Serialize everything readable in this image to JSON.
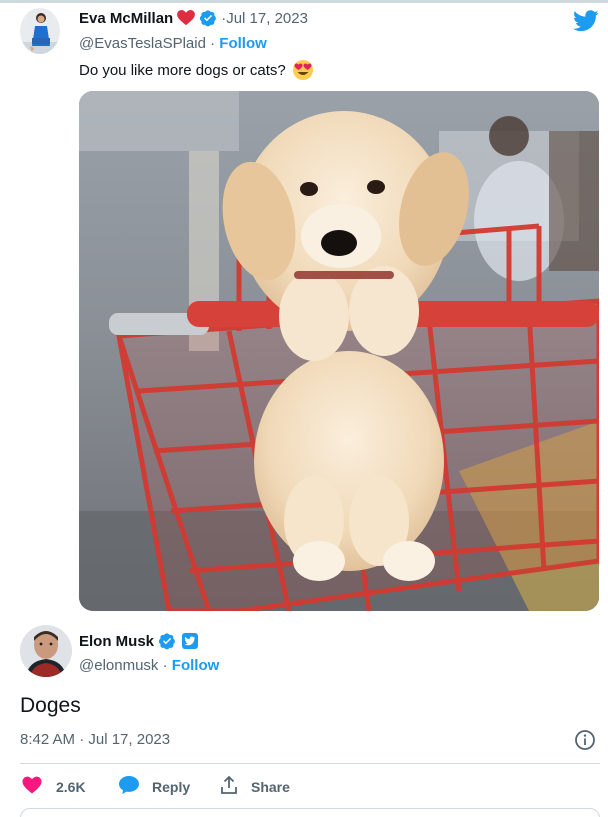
{
  "colors": {
    "accent": "#1d9bf0",
    "text": "#0f1419",
    "muted": "#536471",
    "divider": "#cfd9de",
    "like": "#f91880"
  },
  "quoted_tweet": {
    "author_name": "Eva McMillan",
    "emoji_after_name": "red-heart",
    "date": "Jul 17, 2023",
    "date_prefix": "· ",
    "handle": "@EvasTeslaSPlaid",
    "follow_separator": " · ",
    "follow_label": "Follow",
    "text": "Do you like more dogs or cats?",
    "text_emoji": "heart-eyes-emoji",
    "media": "puppy-in-shopping-cart-photo"
  },
  "main_tweet": {
    "author_name": "Elon Musk",
    "handle": "@elonmusk",
    "follow_separator": " · ",
    "follow_label": "Follow",
    "text": "Doges",
    "timestamp": "8:42 AM · Jul 17, 2023"
  },
  "actions": {
    "likes_count": "2.6K",
    "reply_label": "Reply",
    "share_label": "Share"
  },
  "icons": {
    "brand": "twitter-bird-icon",
    "verified": "verified-badge-icon",
    "info": "info-icon",
    "like": "heart-icon",
    "reply": "speech-bubble-icon",
    "share": "share-upload-icon"
  }
}
